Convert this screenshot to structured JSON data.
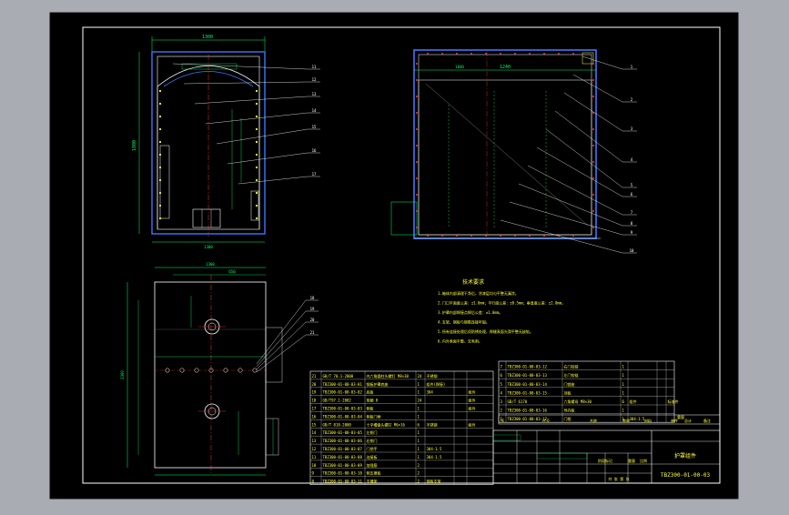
{
  "colors": {
    "chrome": "#a9acb2",
    "canvas": "#000000",
    "frame": "#ffffff",
    "outline": "#ffffff",
    "dimension": "#00ff66",
    "centerline": "#ff3333",
    "wall": "#3b78ff",
    "note_text": "#ffff33",
    "label": "#ffffff"
  },
  "front_view": {
    "width_dim": "1300",
    "height_dim": "1800",
    "label_short": "1300",
    "callouts": [
      "11",
      "12",
      "13",
      "14",
      "15",
      "16",
      "17"
    ]
  },
  "side_view": {
    "width_dim": "1240",
    "note": "1840",
    "callouts": [
      "1",
      "2",
      "3",
      "4",
      "5",
      "6",
      "7",
      "8",
      "9",
      "10"
    ]
  },
  "plan_view": {
    "width_dim": "1300",
    "height_dim": "2300",
    "sub_dim": "650",
    "callouts": [
      "18",
      "19",
      "20",
      "21"
    ]
  },
  "tech_notes": {
    "title": "技术要求",
    "lines": [
      "1.箱体内部清理干净后，涂漆层均匀平整无漏涂。",
      "2.门口平面度公差：±1.0mm；平行度公差：±0.5mm；垂直度公差：±2.0mm。",
      "3.护罩内部焊接点焊后公差：±1.0mm。",
      "4.支架、钢板与钢筋连接牢固。",
      "5.所有连接处理后须防锈处理，焊缝表面光滑平整无缺陷。",
      "6.内外表面平整，无毛刺。"
    ]
  },
  "parts_list_left": [
    [
      "21",
      "GB/T 70.1-2000",
      "内六角圆柱头螺钉 M8×30",
      "24",
      "不锈钢",
      "",
      ""
    ],
    [
      "20",
      "TBZ300-01-00-03-01",
      "钢板护罩底座",
      "1",
      "组件(焊接)",
      "",
      ""
    ],
    [
      "19",
      "TBZ300-01-00-03-02",
      "底板",
      "1",
      "304",
      "",
      "组件"
    ],
    [
      "18",
      "GB/T97.1-2002",
      "垫圈 8",
      "24",
      "",
      "",
      "组件"
    ],
    [
      "17",
      "TBZ300-01-00-03-03",
      "侧板",
      "1",
      "",
      "",
      "组件"
    ],
    [
      "16",
      "TBZ300-01-00-03-04",
      "侧板门框",
      "1",
      "",
      "",
      ""
    ],
    [
      "15",
      "GB/T 818-2000",
      "十字槽盘头螺钉 M6×16",
      "6",
      "不锈钢",
      "",
      "组件"
    ],
    [
      "14",
      "TBZ300-01-00-03-05",
      "左侧门",
      "1",
      "",
      "",
      ""
    ],
    [
      "13",
      "TBZ300-01-00-03-06",
      "右侧门",
      "1",
      "",
      "",
      ""
    ],
    [
      "12",
      "TBZ300-01-00-03-07",
      "门把手",
      "1",
      "304-1.5",
      "",
      ""
    ],
    [
      "11",
      "TBZ300-01-00-03-08",
      "连接板",
      "1",
      "304-1.5",
      "",
      ""
    ],
    [
      "10",
      "TBZ300-01-00-03-09",
      "加强筋",
      "2",
      "",
      "",
      ""
    ],
    [
      "9",
      "TBZ300-01-00-03-10",
      "侧支撑板",
      "2",
      "",
      "",
      ""
    ],
    [
      "8",
      "TBZ300-01-00-03-11",
      "支撑架",
      "2",
      "钢板支架",
      "",
      ""
    ]
  ],
  "parts_list_right": [
    [
      "7",
      "TBZ300-01-00-03-12",
      "右门铰链",
      "1",
      "",
      "",
      ""
    ],
    [
      "6",
      "TBZ300-01-00-03-13",
      "左门铰链",
      "1",
      "",
      "",
      ""
    ],
    [
      "5",
      "TBZ300-01-00-03-14",
      "门锁座",
      "1",
      "",
      "",
      ""
    ],
    [
      "4",
      "TBZ300-01-00-03-15",
      "顶板",
      "1",
      "",
      "",
      ""
    ],
    [
      "3",
      "GB/T 6170",
      "六角螺母 M8×30",
      "6",
      "组件",
      "",
      "标准件"
    ],
    [
      "2",
      "TBZ300-01-00-03-16",
      "导向板",
      "1",
      "",
      "",
      ""
    ],
    [
      "1",
      "TBZ300-01-00-03-17",
      "门框",
      "1",
      "304-1.5",
      "",
      ""
    ]
  ],
  "parts_header": {
    "seq": "序",
    "code": "代号",
    "name": "名称",
    "qty": "数量",
    "material": "材料",
    "unit_weight": "单件",
    "total_weight": "总计",
    "weight": "重量",
    "note": "备注"
  },
  "title_block": {
    "drawing_name": "护罩组件",
    "drawing_code": "TBZ300-01-00-03",
    "stage_label": "阶段标记",
    "weight_label": "重量",
    "scale_label": "比例",
    "sheet_info": "共 张 第 张"
  }
}
